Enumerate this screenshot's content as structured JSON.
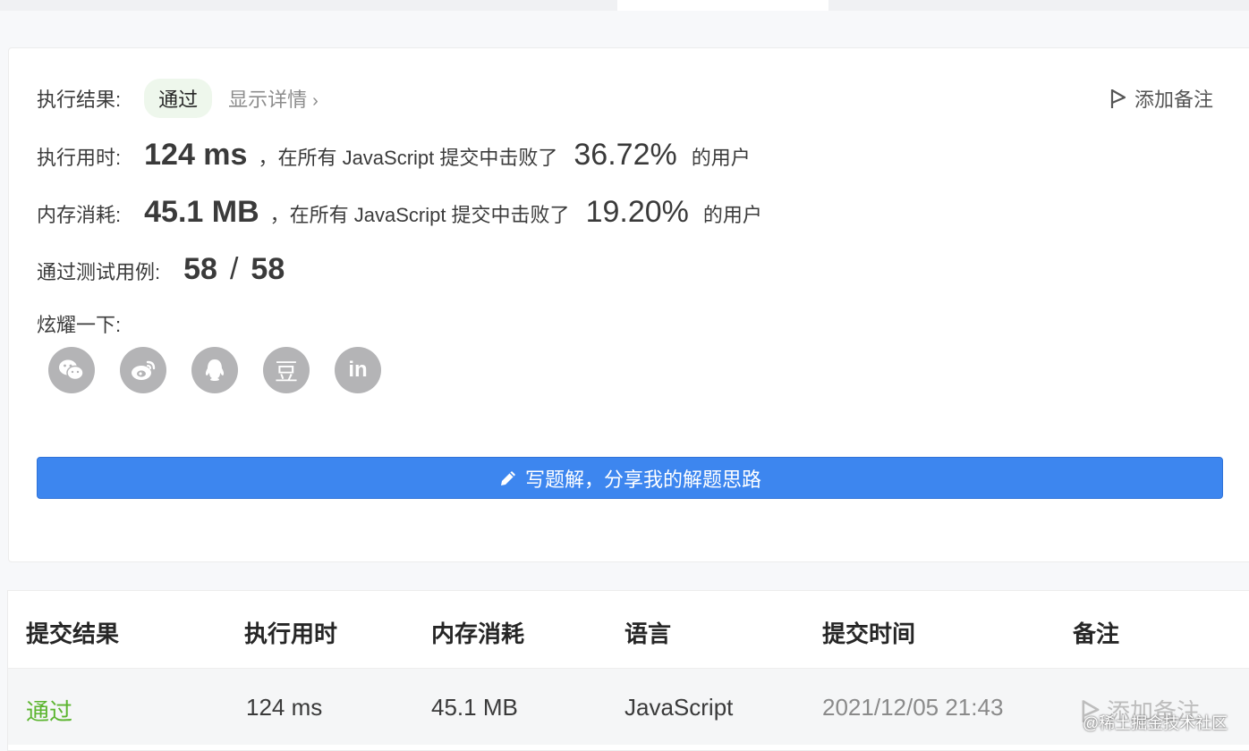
{
  "result": {
    "label": "执行结果:",
    "status": "通过",
    "details_link": "显示详情",
    "details_chevron": "›",
    "add_note": "添加备注"
  },
  "runtime": {
    "label": "执行用时:",
    "value": "124 ms",
    "text_before": "，在所有 JavaScript 提交中击败了",
    "percent": "36.72%",
    "text_after": "的用户"
  },
  "memory": {
    "label": "内存消耗:",
    "value": "45.1 MB",
    "text_before": "，在所有 JavaScript 提交中击败了",
    "percent": "19.20%",
    "text_after": "的用户"
  },
  "tests": {
    "label": "通过测试用例:",
    "passed": "58",
    "separator": "/",
    "total": "58"
  },
  "share": {
    "label": "炫耀一下:",
    "icons": [
      "wechat-icon",
      "weibo-icon",
      "qq-icon",
      "douban-icon",
      "linkedin-icon"
    ],
    "douban_glyph": "豆",
    "linkedin_glyph": "in"
  },
  "solution_button": {
    "label": "写题解，分享我的解题思路"
  },
  "table": {
    "headers": [
      "提交结果",
      "执行用时",
      "内存消耗",
      "语言",
      "提交时间",
      "备注"
    ],
    "rows": [
      {
        "result": "通过",
        "runtime": "124 ms",
        "memory": "45.1 MB",
        "language": "JavaScript",
        "submitted_at": "2021/12/05 21:43",
        "note": "添加备注"
      }
    ]
  },
  "watermark": "@稀土掘金技术社区",
  "colors": {
    "accent_blue": "#3d86ef",
    "pass_green": "#5cb52f",
    "badge_bg": "#eef7ec",
    "icon_gray": "#b4b4b6"
  }
}
